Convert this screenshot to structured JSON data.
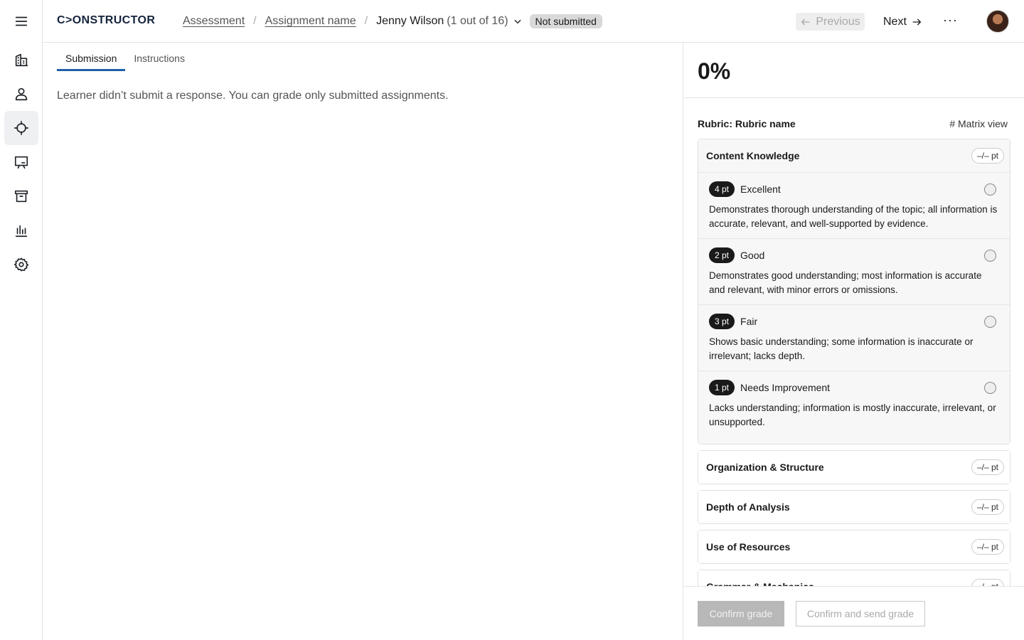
{
  "app": {
    "logo": "C>ONSTRUCTOR"
  },
  "rail": {
    "items": [
      {
        "icon": "menu-icon",
        "active": false
      },
      {
        "icon": "building-icon",
        "active": false
      },
      {
        "icon": "person-icon",
        "active": false
      },
      {
        "icon": "target-icon",
        "active": true
      },
      {
        "icon": "presentation-icon",
        "active": false
      },
      {
        "icon": "archive-icon",
        "active": false
      },
      {
        "icon": "bar-chart-icon",
        "active": false
      },
      {
        "icon": "gear-icon",
        "active": false
      }
    ]
  },
  "header": {
    "breadcrumb_1": "Assessment",
    "breadcrumb_2": "Assignment name",
    "separator": "/",
    "learner_name": "Jenny Wilson",
    "learner_count": "(1 out of 16)",
    "status": "Not submitted",
    "previous_label": "Previous",
    "next_label": "Next",
    "more_label": "···"
  },
  "main": {
    "tabs": [
      {
        "label": "Submission",
        "active": true
      },
      {
        "label": "Instructions",
        "active": false
      }
    ],
    "empty_message": "Learner didn’t submit a response. You can grade only submitted assignments."
  },
  "panel": {
    "score": "0%",
    "rubric_label": "Rubric: Rubric name",
    "matrix_view_label": "# Matrix view",
    "criteria": [
      {
        "name": "Content Knowledge",
        "points": "–/– pt",
        "expanded": true,
        "levels": [
          {
            "pt": "4 pt",
            "name": "Excellent",
            "desc": "Demonstrates thorough understanding of the topic; all information is accurate, relevant, and well-supported by evidence."
          },
          {
            "pt": "2 pt",
            "name": "Good",
            "desc": "Demonstrates good understanding; most information is accurate and relevant, with minor errors or omissions."
          },
          {
            "pt": "3 pt",
            "name": "Fair",
            "desc": "Shows basic understanding; some information is inaccurate or irrelevant; lacks depth."
          },
          {
            "pt": "1 pt",
            "name": "Needs Improvement",
            "desc": "Lacks understanding; information is mostly inaccurate, irrelevant, or unsupported."
          }
        ]
      },
      {
        "name": "Organization & Structure",
        "points": "–/– pt",
        "expanded": false
      },
      {
        "name": "Depth of Analysis",
        "points": "–/– pt",
        "expanded": false
      },
      {
        "name": "Use of Resources",
        "points": "–/– pt",
        "expanded": false
      },
      {
        "name": "Grammar & Mechanics",
        "points": "–/– pt",
        "expanded": false
      }
    ],
    "confirm_label": "Confirm grade",
    "confirm_send_label": "Confirm and send grade"
  }
}
